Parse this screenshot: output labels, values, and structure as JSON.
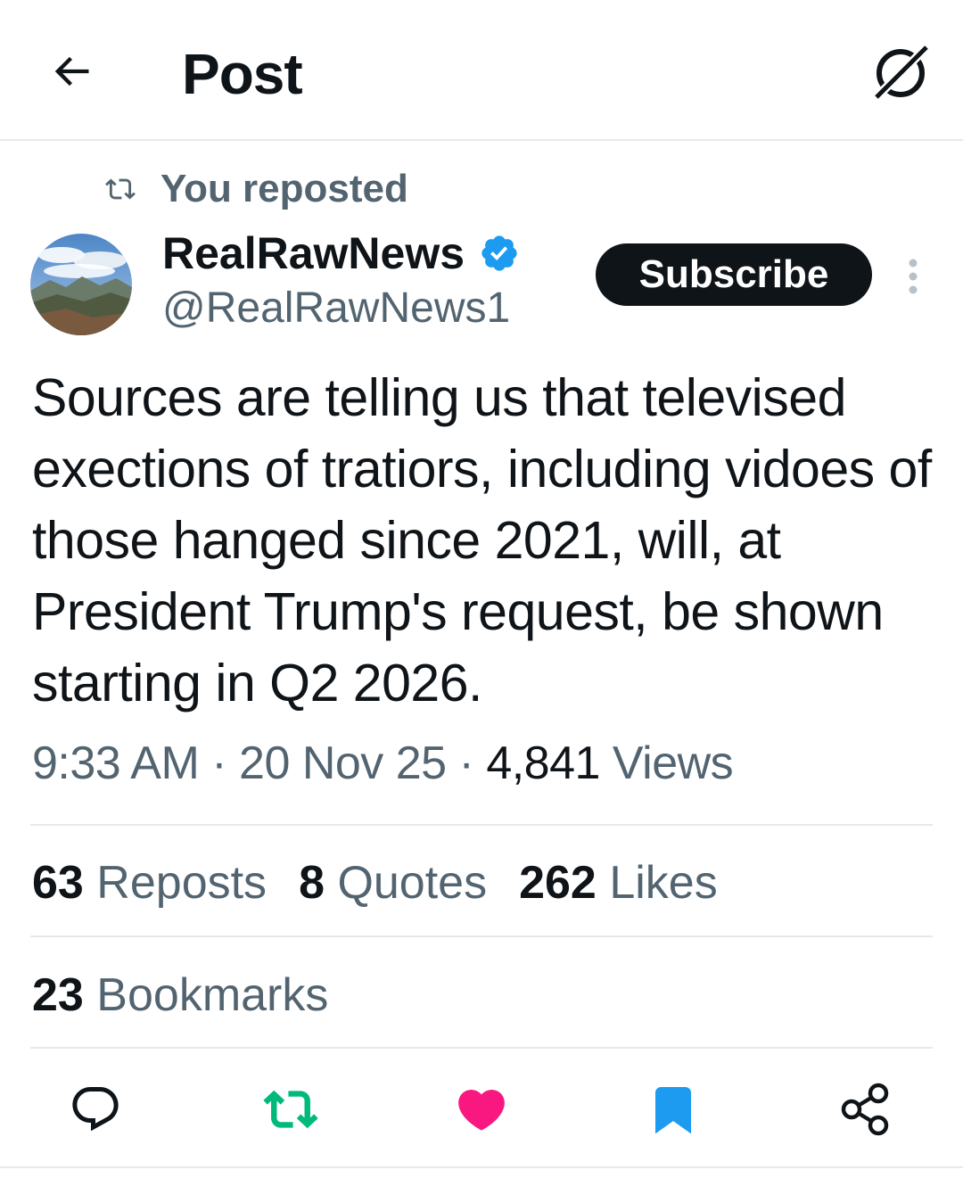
{
  "header": {
    "title": "Post",
    "back_icon": "arrow-left-icon",
    "grok_icon": "grok-icon"
  },
  "repost_context": {
    "label": "You reposted",
    "icon": "repost-icon"
  },
  "author": {
    "name": "RealRawNews",
    "handle": "@RealRawNews1",
    "verified": true,
    "verified_color": "#1d9bf0"
  },
  "subscribe_label": "Subscribe",
  "post": {
    "text": "Sources are telling us that televised exections of tratiors, including vidoes of those hanged since 2021, will, at President Trump's request, be shown starting in Q2 2026.",
    "time": "9:33 AM",
    "sep1": "·",
    "date": "20 Nov 25",
    "sep2": "·",
    "views_count": "4,841",
    "views_label": "Views"
  },
  "stats": {
    "reposts_count": "63",
    "reposts_label": "Reposts",
    "quotes_count": "8",
    "quotes_label": "Quotes",
    "likes_count": "262",
    "likes_label": "Likes",
    "bookmarks_count": "23",
    "bookmarks_label": "Bookmarks"
  },
  "actions": {
    "reply_icon": "reply-icon",
    "repost_icon": "repost-icon",
    "like_icon": "heart-icon",
    "bookmark_icon": "bookmark-icon",
    "share_icon": "share-icon",
    "repost_active_color": "#00ba7c",
    "like_active_color": "#f91880",
    "bookmark_active_color": "#1d9bf0"
  }
}
